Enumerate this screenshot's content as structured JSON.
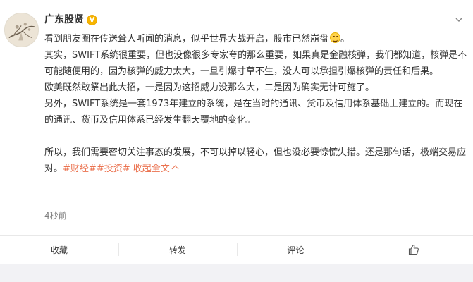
{
  "post": {
    "author": "广东股贤",
    "verified_badge": "V",
    "timestamp": "4秒前",
    "paragraphs": [
      "看到朋友圈在传送耸人听闻的消息，似乎世界大战开启，股市已然崩盘",
      "。",
      "其实，SWIFT系统很重要，但也没像很多专家夸的那么重要，如果真是金融核弹，我们都知道，核弹是不可能随便用的，因为核弹的威力太大，一旦引爆寸草不生，没人可以承担引爆核弹的责任和后果。",
      "欧美既然敢祭出此大招，一是因为这招威力没那么大，二是因为确实无计可施了。",
      "另外，SWIFT系统是一套1973年建立的系统，是在当时的通讯、货币及信用体系基础上建立的。而现在的通讯、货币及信用体系已经发生翻天覆地的变化。",
      "所以，我们需要密切关注事态的发展，不可以掉以轻心，但也没必要惊慌失措。还是那句话，极端交易应对。"
    ],
    "hashtags": [
      "#财经#",
      "#投资#"
    ],
    "collapse_label": "收起全文"
  },
  "actions": {
    "favorite": "收藏",
    "repost": "转发",
    "comment": "评论"
  },
  "icons": {
    "verified": "verified-v-icon",
    "dropdown": "chevron-down-icon",
    "emoji": "laugh-cry-emoji-icon",
    "like": "thumbs-up-icon"
  },
  "colors": {
    "link": "#eb7350",
    "badge": "#f7b500"
  }
}
